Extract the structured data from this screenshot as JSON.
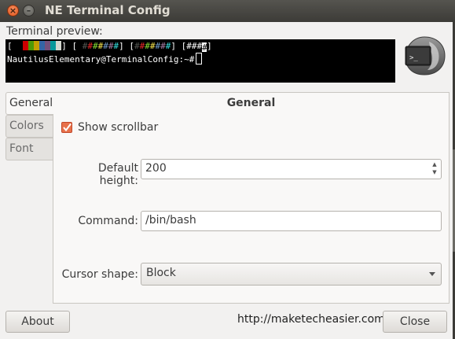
{
  "window": {
    "title": "NE Terminal Config"
  },
  "preview": {
    "label": "Terminal preview:",
    "line1_colors": [
      "#000000",
      "#cc0000",
      "#4e9a06",
      "#c4a000",
      "#3465a4",
      "#75507b",
      "#06989a",
      "#d3d7cf"
    ],
    "line1_hash_colors_a": [
      "#555753",
      "#ef2929",
      "#8ae234",
      "#fce94f",
      "#729fcf",
      "#ad7fa8",
      "#34e2e2"
    ],
    "line1_hash_colors_b": [
      "#555753",
      "#ef2929",
      "#8ae234",
      "#fce94f",
      "#729fcf",
      "#ad7fa8",
      "#34e2e2"
    ],
    "prompt": "NautilusElementary@TerminalConfig:~#"
  },
  "tabs": [
    {
      "label": "General",
      "active": true
    },
    {
      "label": "Colors",
      "active": false
    },
    {
      "label": "Font",
      "active": false
    }
  ],
  "general": {
    "title": "General",
    "show_scrollbar": {
      "label": "Show scrollbar",
      "checked": true
    },
    "default_height": {
      "label": "Default height:",
      "value": "200"
    },
    "command": {
      "label": "Command:",
      "value": "/bin/bash"
    },
    "cursor_shape": {
      "label": "Cursor shape:",
      "value": "Block"
    }
  },
  "buttons": {
    "about": "About",
    "close": "Close"
  },
  "watermark": "http://maketecheasier.com",
  "colors": {
    "accent": "#e8714a",
    "titlebar": "#3c3b37",
    "terminal_bg": "#000000"
  }
}
